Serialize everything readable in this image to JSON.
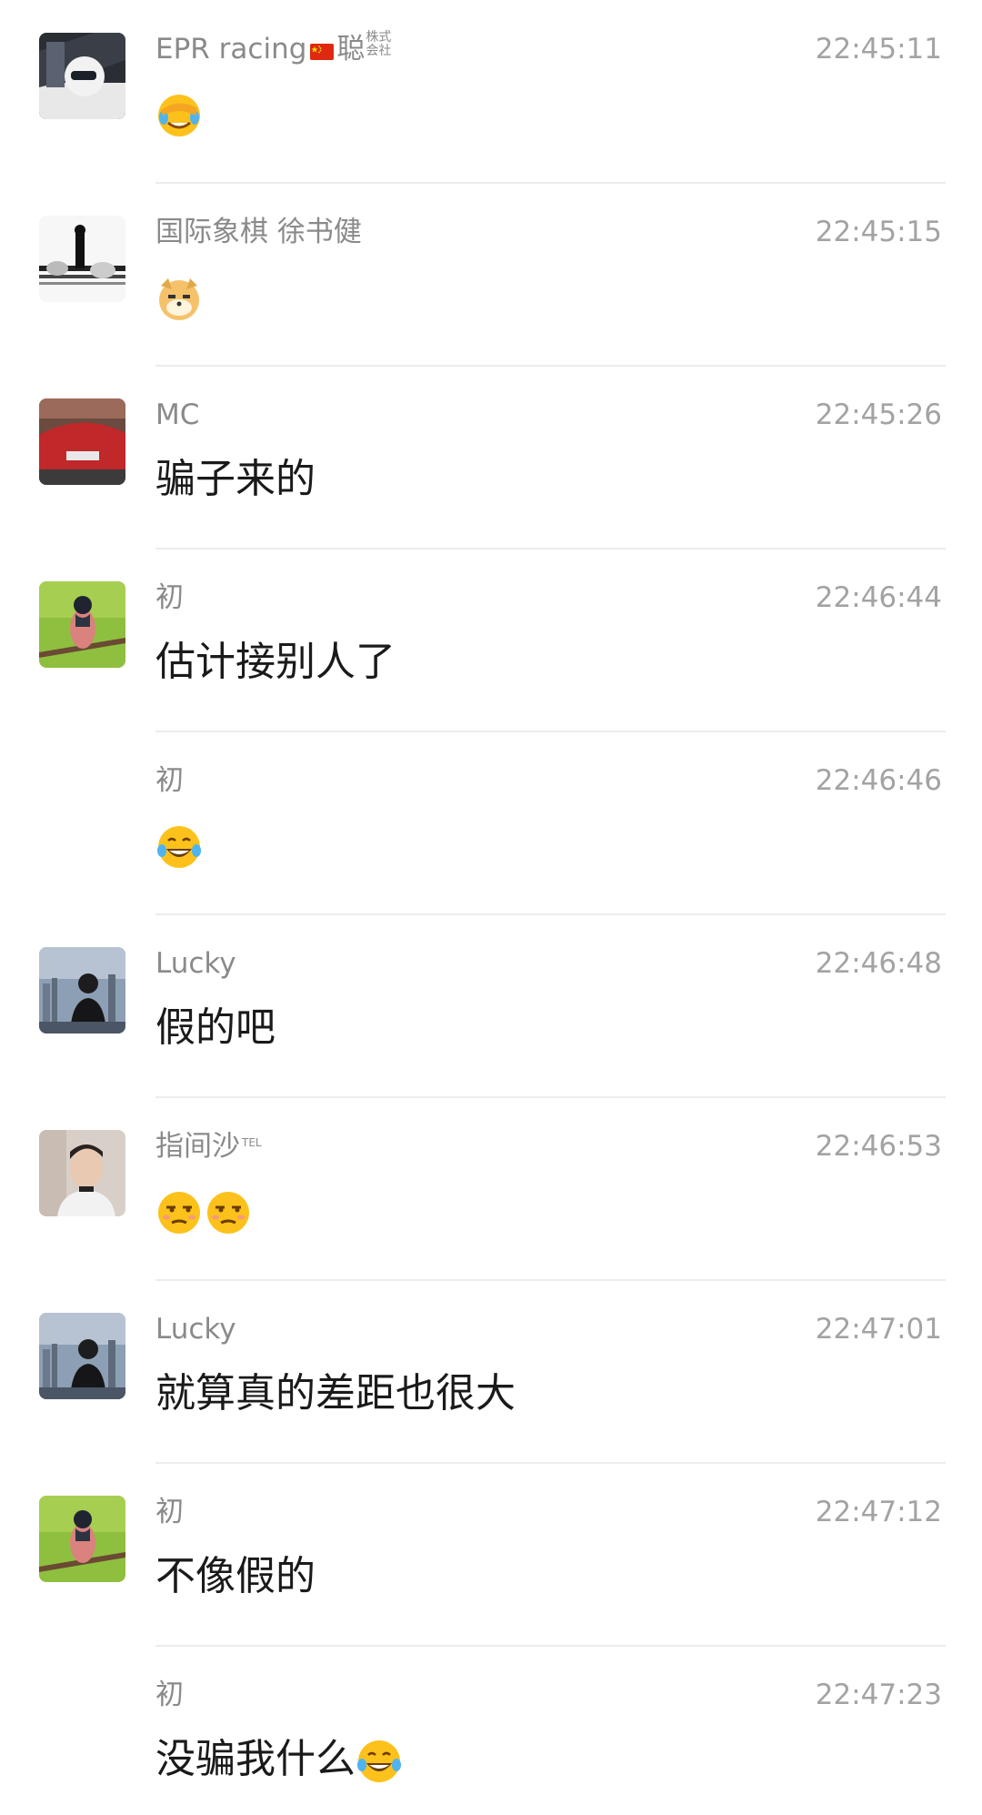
{
  "messages": [
    {
      "sender": "EPR racing",
      "sender_suffix": "聪",
      "sender_small_suffix": "株式会社",
      "flag": "china-flag",
      "time": "22:45:11",
      "text": "",
      "emojis": [
        "facepalm-laugh-emoji"
      ]
    },
    {
      "sender": "国际象棋 徐书健",
      "time": "22:45:15",
      "text": "",
      "emojis": [
        "doge-emoji"
      ]
    },
    {
      "sender": "MC",
      "time": "22:45:26",
      "text": "骗子来的",
      "emojis": []
    },
    {
      "sender": "初",
      "time": "22:46:44",
      "text": "估计接别人了",
      "emojis": []
    },
    {
      "sender": "初",
      "time": "22:46:46",
      "text": "",
      "emojis": [
        "tears-of-joy-emoji"
      ]
    },
    {
      "sender": "Lucky",
      "time": "22:46:48",
      "text": "假的吧",
      "emojis": []
    },
    {
      "sender": "指间沙",
      "sender_sup": "TEL",
      "time": "22:46:53",
      "text": "",
      "emojis": [
        "unamused-emoji",
        "unamused-emoji"
      ]
    },
    {
      "sender": "Lucky",
      "time": "22:47:01",
      "text": "就算真的差距也很大",
      "emojis": []
    },
    {
      "sender": "初",
      "time": "22:47:12",
      "text": "不像假的",
      "emojis": []
    },
    {
      "sender": "初",
      "time": "22:47:23",
      "text": "没骗我什么",
      "emojis": [
        "tears-of-joy-emoji"
      ]
    }
  ],
  "colors": {
    "name": "#8a8a8a",
    "time": "#a3a3a3",
    "text": "#1a1a1a",
    "divider": "#ececec"
  }
}
